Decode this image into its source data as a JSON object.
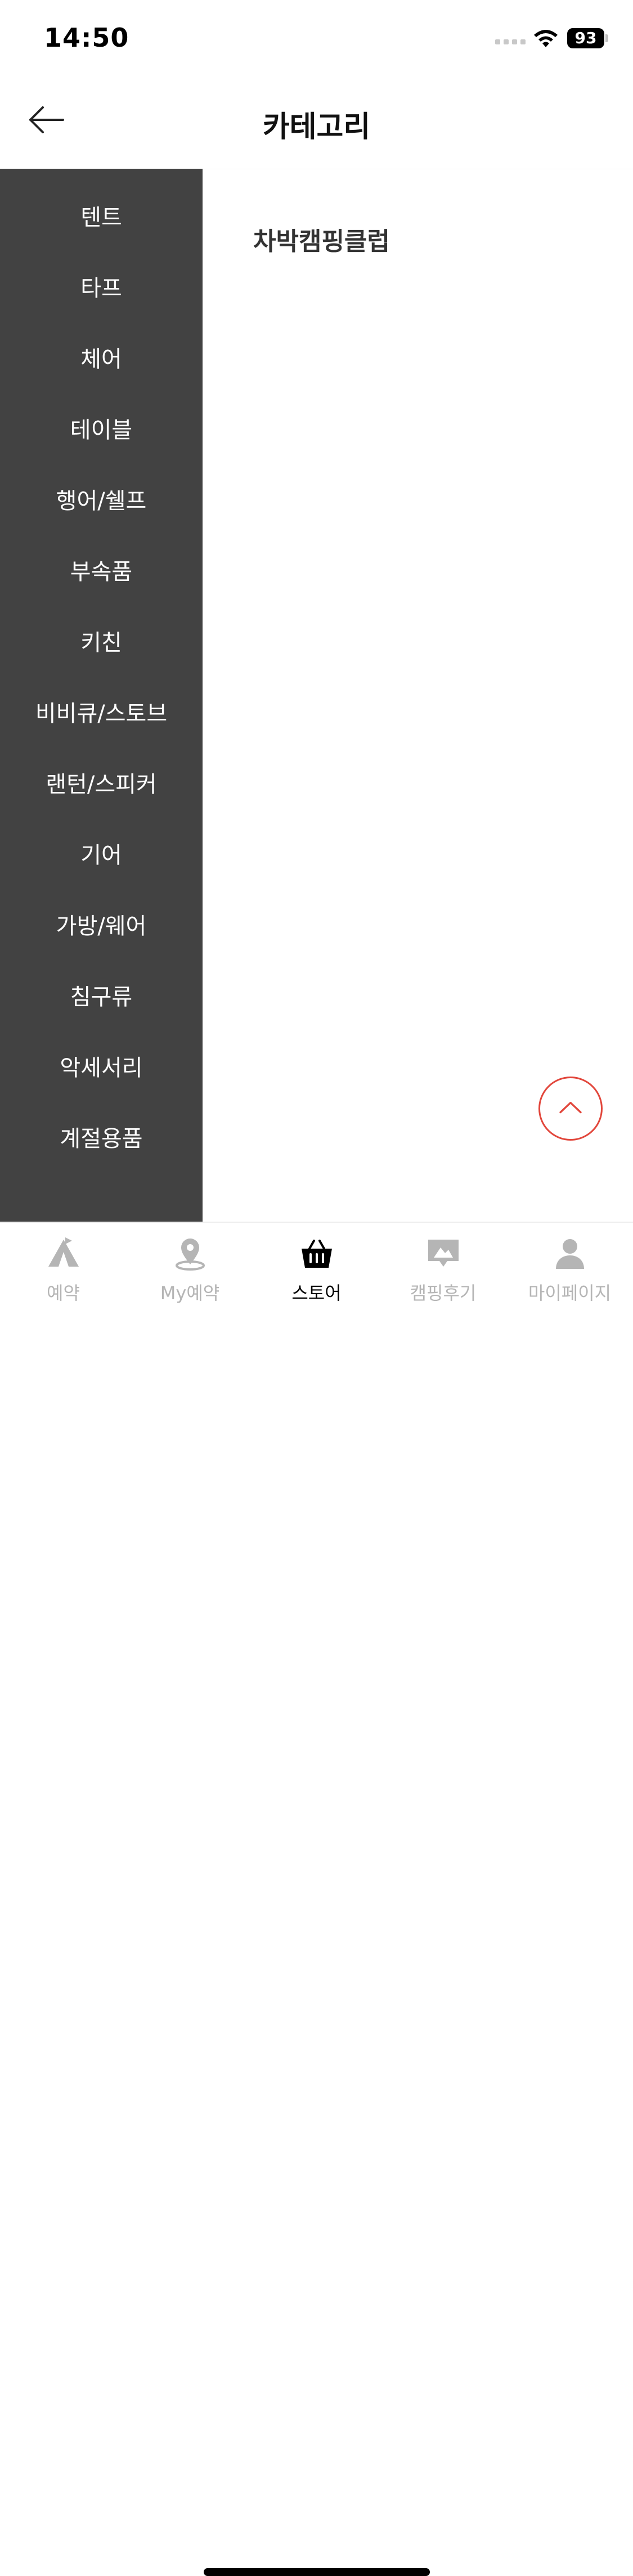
{
  "status": {
    "time": "14:50",
    "battery": "93"
  },
  "header": {
    "title": "카테고리"
  },
  "sidebar": {
    "items": [
      {
        "label": "텐트"
      },
      {
        "label": "타프"
      },
      {
        "label": "체어"
      },
      {
        "label": "테이블"
      },
      {
        "label": "행어/쉘프"
      },
      {
        "label": "부속품"
      },
      {
        "label": "키친"
      },
      {
        "label": "비비큐/스토브"
      },
      {
        "label": "랜턴/스피커"
      },
      {
        "label": "기어"
      },
      {
        "label": "가방/웨어"
      },
      {
        "label": "침구류"
      },
      {
        "label": "악세서리"
      },
      {
        "label": "계절용품"
      },
      {
        "label": "",
        "note": "partially hidden item"
      }
    ]
  },
  "main": {
    "brand_title": "차박캠핑클럽"
  },
  "nav": {
    "items": [
      {
        "label": "예약",
        "icon": "tent-icon"
      },
      {
        "label": "My예약",
        "icon": "location-pin-icon"
      },
      {
        "label": "스토어",
        "icon": "shopping-basket-icon",
        "active": true
      },
      {
        "label": "캠핑후기",
        "icon": "review-image-icon"
      },
      {
        "label": "마이페이지",
        "icon": "person-icon"
      }
    ]
  },
  "colors": {
    "sidebar_bg": "#424242",
    "accent": "#e2473c",
    "inactive": "#b5b5b5"
  }
}
